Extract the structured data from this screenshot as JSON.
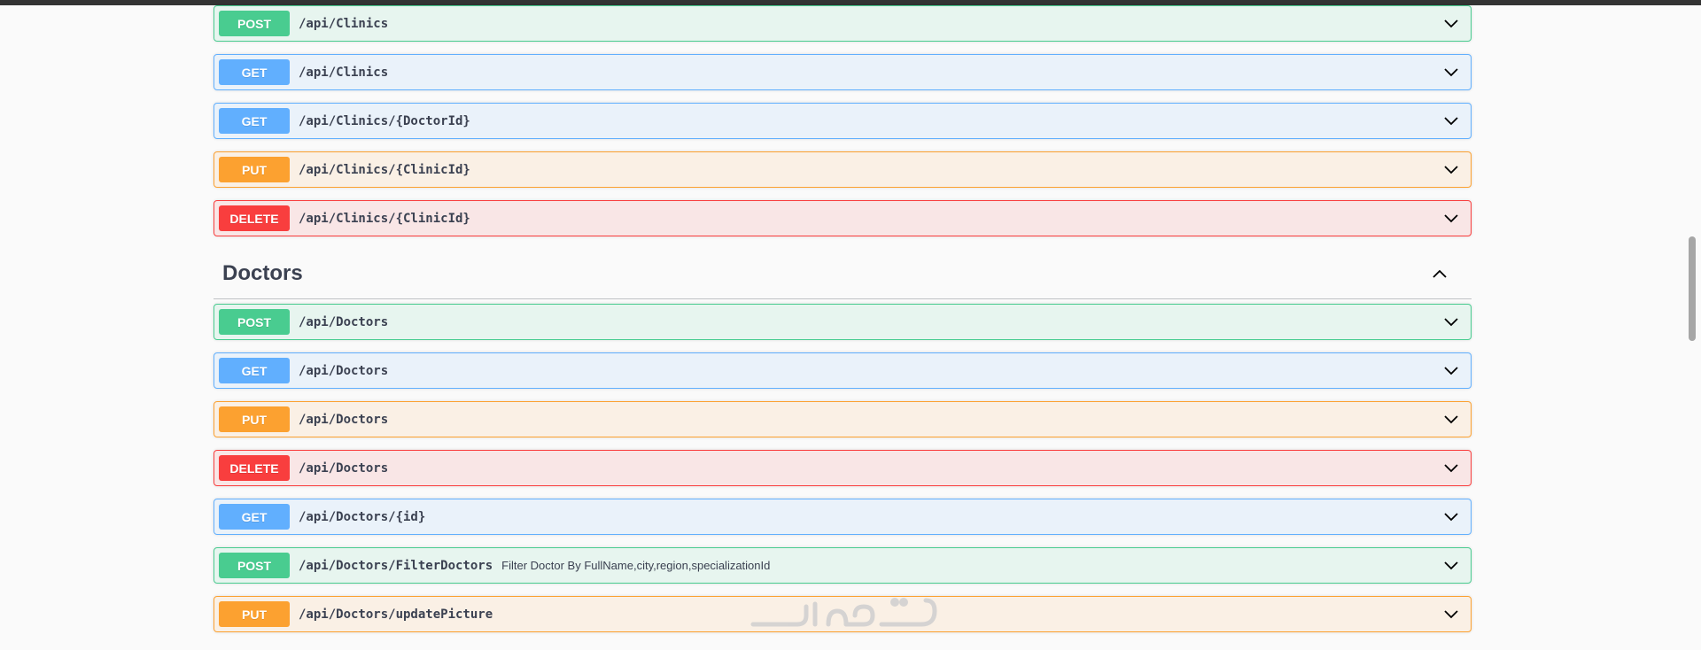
{
  "clinics_ops": [
    {
      "method": "POST",
      "path": "/api/Clinics",
      "kind": "post"
    },
    {
      "method": "GET",
      "path": "/api/Clinics",
      "kind": "get"
    },
    {
      "method": "GET",
      "path": "/api/Clinics/{DoctorId}",
      "kind": "get"
    },
    {
      "method": "PUT",
      "path": "/api/Clinics/{ClinicId}",
      "kind": "put"
    },
    {
      "method": "DELETE",
      "path": "/api/Clinics/{ClinicId}",
      "kind": "delete"
    }
  ],
  "doctors_section": {
    "title": "Doctors",
    "expanded_icon": "chevron-up-icon"
  },
  "doctors_ops": [
    {
      "method": "POST",
      "path": "/api/Doctors",
      "kind": "post"
    },
    {
      "method": "GET",
      "path": "/api/Doctors",
      "kind": "get"
    },
    {
      "method": "PUT",
      "path": "/api/Doctors",
      "kind": "put"
    },
    {
      "method": "DELETE",
      "path": "/api/Doctors",
      "kind": "delete"
    },
    {
      "method": "GET",
      "path": "/api/Doctors/{id}",
      "kind": "get"
    },
    {
      "method": "POST",
      "path": "/api/Doctors/FilterDoctors",
      "summary": "Filter Doctor By FullName,city,region,specializationId",
      "kind": "post"
    },
    {
      "method": "PUT",
      "path": "/api/Doctors/updatePicture",
      "kind": "put"
    }
  ],
  "colors": {
    "post": "#49cc90",
    "get": "#61affe",
    "put": "#fca130",
    "delete": "#f93e3e",
    "text": "#3b4151"
  },
  "watermark": {
    "icon": "khamsat-watermark-logo",
    "text": "خمسات"
  }
}
